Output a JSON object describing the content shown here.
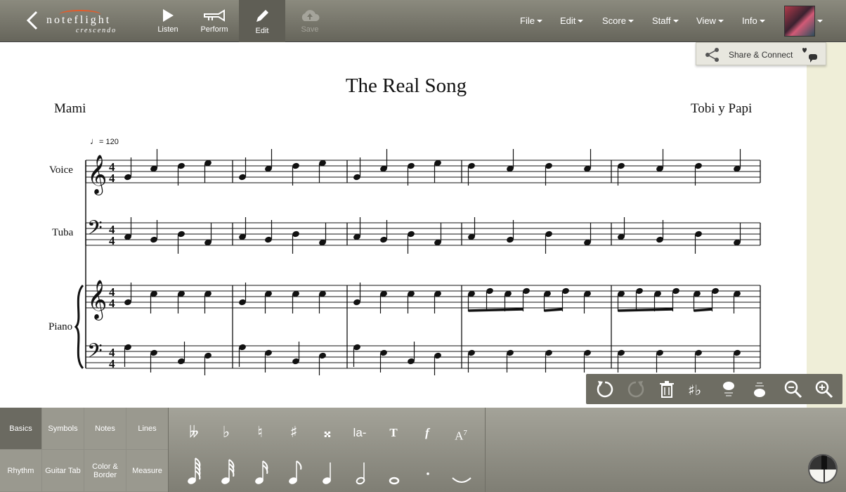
{
  "app": {
    "logo_name": "noteflight",
    "logo_sub": "crescendo"
  },
  "toolbar": {
    "listen": "Listen",
    "perform": "Perform",
    "edit": "Edit",
    "save": "Save"
  },
  "menus": [
    "File",
    "Edit",
    "Score",
    "Staff",
    "View",
    "Info"
  ],
  "share": {
    "label": "Share & Connect"
  },
  "score": {
    "title": "The Real Song",
    "lyricist": "Mami",
    "composer": "Tobi y Papi",
    "tempo": "= 120",
    "time_signature": "4/4",
    "instruments": [
      "Voice",
      "Tuba",
      "Piano"
    ]
  },
  "palette": {
    "tabs": [
      "Basics",
      "Symbols",
      "Notes",
      "Lines",
      "Rhythm",
      "Guitar Tab",
      "Color & Border",
      "Measure"
    ],
    "active_tab": "Basics",
    "row1": [
      "𝄫",
      "♭",
      "♮",
      "♯",
      "𝄪",
      "la-",
      "T",
      "f",
      "A7"
    ],
    "row2": [
      "64th",
      "32nd",
      "16th",
      "8th",
      "quarter",
      "half",
      "whole",
      "dot",
      "tie"
    ]
  },
  "colors": {
    "toolbar": "#77766b",
    "accent": "#e35b2a",
    "strip": "#efeed8"
  }
}
